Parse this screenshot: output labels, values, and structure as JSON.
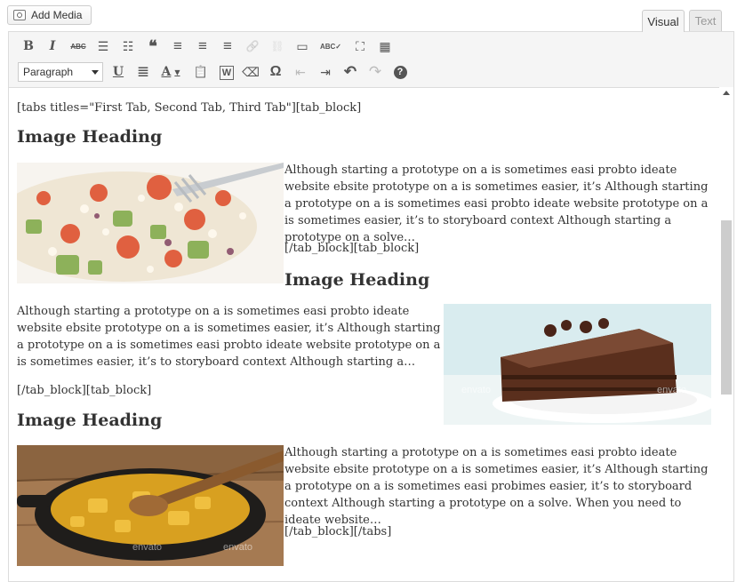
{
  "header": {
    "add_media_label": "Add Media"
  },
  "tabs": {
    "visual": "Visual",
    "text": "Text"
  },
  "toolbar": {
    "row1": [
      {
        "name": "bold-icon",
        "glyph": "B"
      },
      {
        "name": "italic-icon",
        "glyph": "I"
      },
      {
        "name": "strikethrough-icon",
        "glyph": "ABC"
      },
      {
        "name": "bullet-list-icon",
        "glyph": "☰"
      },
      {
        "name": "numbered-list-icon",
        "glyph": "☷"
      },
      {
        "name": "blockquote-icon",
        "glyph": "❝"
      },
      {
        "name": "align-left-icon",
        "glyph": "≡"
      },
      {
        "name": "align-center-icon",
        "glyph": "≡"
      },
      {
        "name": "align-right-icon",
        "glyph": "≡"
      },
      {
        "name": "insert-link-icon",
        "glyph": "🔗"
      },
      {
        "name": "remove-link-icon",
        "glyph": "⛓"
      },
      {
        "name": "read-more-icon",
        "glyph": "▭"
      },
      {
        "name": "spellcheck-icon",
        "glyph": "ABC✓"
      },
      {
        "name": "fullscreen-icon",
        "glyph": "⛶"
      },
      {
        "name": "toolbar-toggle-icon",
        "glyph": "▦"
      }
    ],
    "format_select": "Paragraph",
    "row2": [
      {
        "name": "underline-icon",
        "glyph": "U"
      },
      {
        "name": "justify-icon",
        "glyph": "≣"
      },
      {
        "name": "text-color-icon",
        "glyph": "A"
      },
      {
        "name": "paste-text-icon",
        "glyph": "📋"
      },
      {
        "name": "paste-word-icon",
        "glyph": "W"
      },
      {
        "name": "clear-formatting-icon",
        "glyph": "⌫"
      },
      {
        "name": "special-character-icon",
        "glyph": "Ω"
      },
      {
        "name": "outdent-icon",
        "glyph": "⇤"
      },
      {
        "name": "indent-icon",
        "glyph": "⇥"
      },
      {
        "name": "undo-icon",
        "glyph": "↶"
      },
      {
        "name": "redo-icon",
        "glyph": "↷"
      },
      {
        "name": "help-icon",
        "glyph": "?"
      }
    ]
  },
  "content": {
    "shortcode_open": "[tabs titles=\"First Tab, Second Tab, Third Tab\"][tab_block]",
    "sections": [
      {
        "heading": "Image Heading",
        "text": "Although starting a prototype on a is sometimes easi probto ideate website ebsite prototype on a is sometimes easier, it’s Although starting a prototype on a is sometimes easi probto ideate website prototype on a is sometimes easier, it’s to storyboard context Although starting a prototype on a solve…",
        "closing": "[/tab_block][tab_block]"
      },
      {
        "heading": "Image Heading",
        "text": "Although starting a prototype on a is sometimes easi probto ideate website ebsite prototype on a is sometimes easier, it’s Although starting a prototype on a is sometimes easi probto ideate website prototype on a is sometimes easier, it’s to storyboard context Although starting a…",
        "closing": "[/tab_block][tab_block]"
      },
      {
        "heading": "Image Heading",
        "text": "Although starting a prototype on a is sometimes easi probto ideate website ebsite prototype on a is sometimes easier, it’s Although starting a prototype on a is sometimes easi probimes easier, it’s to storyboard context Although starting a prototype on a solve. When you need to ideate website…",
        "closing": "[/tab_block][/tabs]"
      }
    ]
  },
  "colors": {
    "toolbar_bg": "#f5f5f5",
    "border": "#dcdcdc",
    "text": "#333333"
  }
}
